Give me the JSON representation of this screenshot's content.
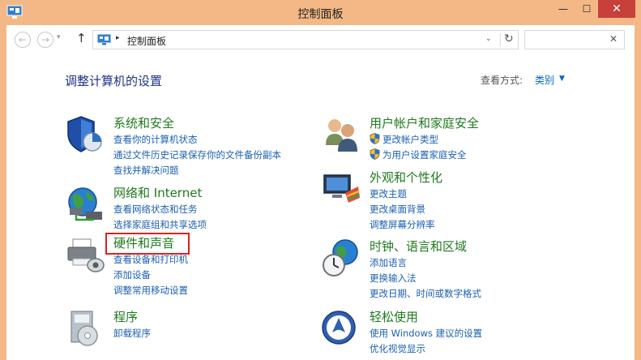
{
  "window": {
    "title": "控制面板"
  },
  "titlebar": {
    "minimize": "—",
    "maximize": "☐",
    "close": "✕"
  },
  "nav": {
    "back": "←",
    "forward": "→",
    "dropdown": "▾",
    "up": "↑",
    "address_separator": "▸",
    "address": "控制面板",
    "address_chevron": "⌄",
    "refresh": "↻",
    "search_placeholder": "",
    "search_clear": "✕"
  },
  "header": {
    "title": "调整计算机的设置",
    "view_label": "查看方式:",
    "view_value": "类别",
    "view_arrow": "▼"
  },
  "categories": [
    {
      "title": "系统和安全",
      "icon": "shield-pie-icon",
      "links": [
        "查看你的计算机状态",
        "通过文件历史记录保存你的文件备份副本",
        "查找并解决问题"
      ]
    },
    {
      "title": "网络和 Internet",
      "icon": "globe-network-icon",
      "links": [
        "查看网络状态和任务",
        "选择家庭组和共享选项"
      ]
    },
    {
      "title": "硬件和声音",
      "icon": "printer-speaker-icon",
      "links": [
        "查看设备和打印机",
        "添加设备",
        "调整常用移动设置"
      ]
    },
    {
      "title": "程序",
      "icon": "program-disc-icon",
      "links": [
        "卸载程序"
      ]
    },
    {
      "title": "用户帐户和家庭安全",
      "icon": "users-icon",
      "links": [
        "更改帐户类型",
        "为用户设置家庭安全"
      ]
    },
    {
      "title": "外观和个性化",
      "icon": "monitor-palette-icon",
      "links": [
        "更改主题",
        "更改桌面背景",
        "调整屏幕分辨率"
      ]
    },
    {
      "title": "时钟、语言和区域",
      "icon": "clock-globe-icon",
      "links": [
        "添加语言",
        "更换输入法",
        "更改日期、时间或数字格式"
      ]
    },
    {
      "title": "轻松使用",
      "icon": "accessibility-icon",
      "links": [
        "使用 Windows 建议的设置",
        "优化视觉显示"
      ]
    }
  ],
  "colors": {
    "titlebar": "#f3b886",
    "close_button": "#c7403a",
    "category_title": "#1e7a1e",
    "link": "#1a5fb4",
    "page_title": "#1e3287",
    "highlight": "#e02020"
  }
}
